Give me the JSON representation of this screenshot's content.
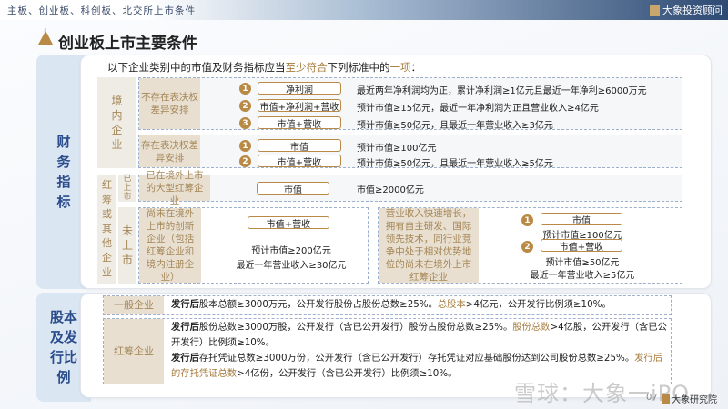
{
  "header": {
    "title": "主板、创业板、科创板、北交所上市条件",
    "brand": "大象投资顾问"
  },
  "page_title": "创业板上市主要条件",
  "financial": {
    "side_label": "财务指标",
    "intro": {
      "pre": "以下企业类别中的市值及财务指标应当",
      "hl1": "至少符合",
      "mid": "下列标准中的",
      "hl2": "一项",
      "post": "："
    },
    "domestic": {
      "label": "境内企业",
      "no_vote": {
        "label": "不存在表决权差异安排",
        "items": [
          {
            "n": "1",
            "pill": "净利润",
            "text": "最近两年净利润均为正，累计净利润≥1亿元且最近一年净利≥6000万元"
          },
          {
            "n": "2",
            "pill": "市值+净利润+营收",
            "text": "预计市值≥15亿元，最近一年净利润为正且营业收入≥4亿元"
          },
          {
            "n": "3",
            "pill": "市值+营收",
            "text": "预计市值≥50亿元，且最近一年营业收入≥3亿元"
          }
        ]
      },
      "vote": {
        "label": "存在表决权差异安排",
        "items": [
          {
            "n": "1",
            "pill": "市值",
            "text": "预计市值≥100亿元"
          },
          {
            "n": "2",
            "pill": "市值+营收",
            "text": "预计市值≥50亿元，且最近一年营业收入≥5亿元"
          }
        ]
      }
    },
    "redchip": {
      "label": "红筹或其他企业",
      "listed": {
        "label": "已上市",
        "desc": "已在境外上市的大型红筹企业",
        "pill": "市值",
        "text": "市值≥2000亿元"
      },
      "unlisted": {
        "label": "未上市",
        "a": {
          "desc": "尚未在境外上市的创新企业（包括红筹企业和境内注册企业）",
          "pill": "市值+营收",
          "line1": "预计市值≥200亿元",
          "line2": "最近一年营业收入≥30亿元"
        },
        "b": {
          "desc": "营业收入快速增长，拥有自主研发、国际领先技术，同行业竞争中处于相对优势地位的尚未在境外上市红筹企业",
          "items": [
            {
              "n": "1",
              "pill": "市值",
              "line1": "预计市值≥100亿元"
            },
            {
              "n": "2",
              "pill": "市值+营收",
              "line1": "预计市值≥50亿元",
              "line2": "最近一年营业收入≥5亿元"
            }
          ]
        }
      }
    }
  },
  "equity": {
    "side_label": "股本及发行比例",
    "general": {
      "label": "一般企业",
      "b1": "发行后",
      "t1": "股本总额≥3000万元，公开发行股份占股份总数≥25%。",
      "h1": "总股本",
      "t2": ">4亿元，公开发行比例须≥10%。"
    },
    "redchip": {
      "label": "红筹企业",
      "p1": {
        "b": "发行后",
        "t1": "股份总数≥3000万股，公开发行（含已公开发行）股份占股份总数≥25%。",
        "h": "股份总数",
        "t2": ">4亿股，公开发行（含已公开发行）比例须≥10%。"
      },
      "p2": {
        "b": "发行后",
        "t1": "存托凭证总数≥3000万份，公开发行（含已公开发行）存托凭证对应基础股份达到公司股份总数≥25%。",
        "h": "发行后的存托凭证总数",
        "t2": ">4亿份，公开发行（含已公开发行）比例须≥10%。"
      }
    }
  },
  "footer": {
    "watermark": "雪球：大象一iPO",
    "page": "07",
    "brand": "大象研究院"
  }
}
